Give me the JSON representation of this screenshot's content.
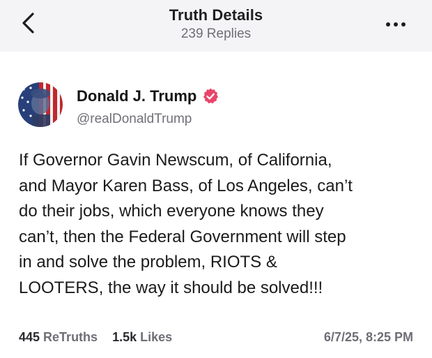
{
  "header": {
    "title": "Truth Details",
    "subtitle": "239 Replies",
    "back_icon": "chevron-left-icon",
    "more_icon": "ellipsis-icon"
  },
  "author": {
    "name": "Donald J. Trump",
    "handle": "@realDonaldTrump",
    "verified_icon": "verified-badge-icon",
    "verified_color": "#e8456b"
  },
  "post": {
    "text": "If Governor Gavin Newscum, of California,\nand Mayor Karen Bass, of Los Angeles, can’t\ndo their jobs, which everyone knows they\ncan’t, then the Federal Government will step\nin and solve the problem, RIOTS &\nLOOTERS, the way it should be solved!!!"
  },
  "stats": {
    "retruths_count": "445",
    "retruths_label": "ReTruths",
    "likes_count": "1.5k",
    "likes_label": "Likes",
    "timestamp": "6/7/25, 8:25 PM"
  }
}
